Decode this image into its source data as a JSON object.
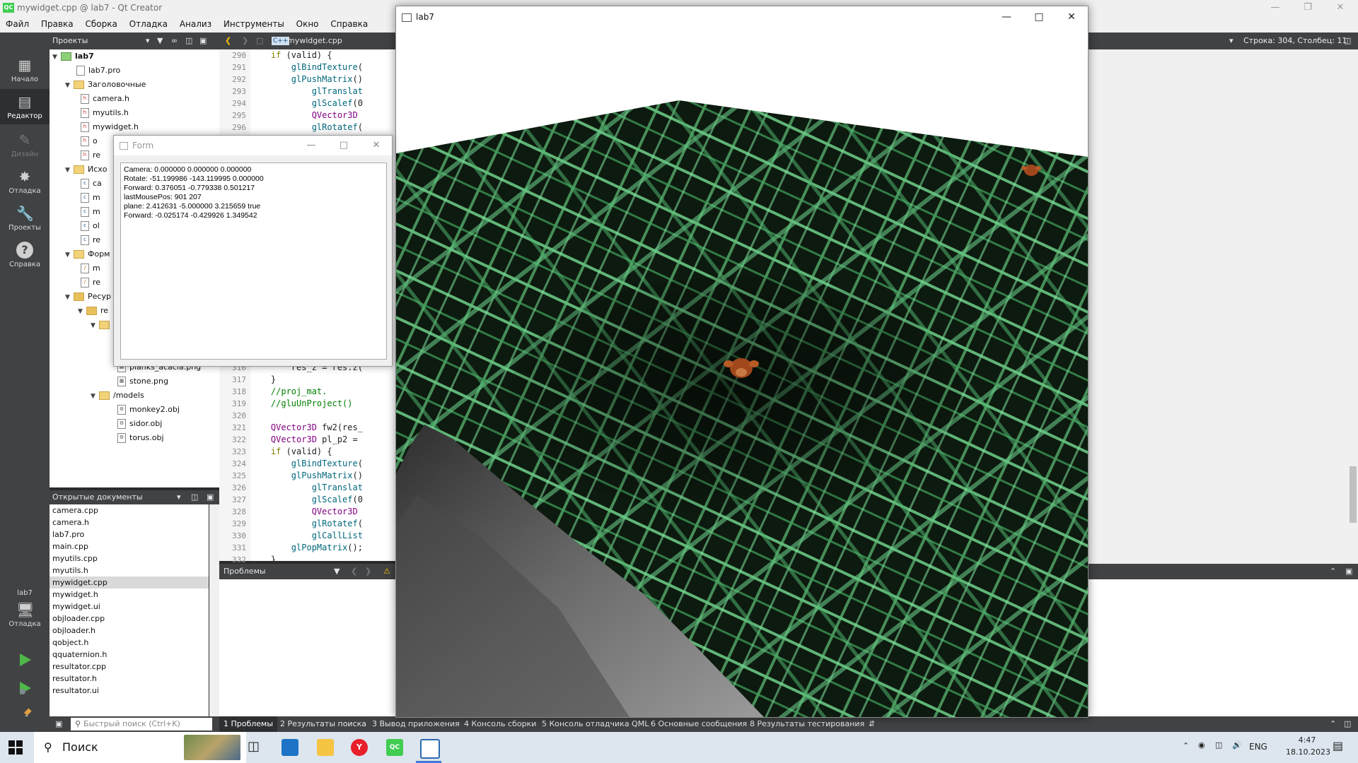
{
  "window_title": "mywidget.cpp @ lab7 - Qt Creator",
  "menu": [
    "Файл",
    "Правка",
    "Сборка",
    "Отладка",
    "Анализ",
    "Инструменты",
    "Окно",
    "Справка"
  ],
  "modes": [
    {
      "label": "Начало",
      "icon": "grid-icon"
    },
    {
      "label": "Редактор",
      "icon": "editor-icon"
    },
    {
      "label": "Дизайн",
      "icon": "design-pen-icon"
    },
    {
      "label": "Отладка",
      "icon": "debug-bug-icon"
    },
    {
      "label": "Проекты",
      "icon": "wrench-icon"
    },
    {
      "label": "Справка",
      "icon": "help-icon"
    }
  ],
  "kit": {
    "name": "lab7",
    "mode": "Отладка"
  },
  "toolbar": {
    "projects_label": "Проекты",
    "file_tab": "mywidget.cpp",
    "cursor_pos": "Строка: 304, Столбец: 11"
  },
  "tree": {
    "root": "lab7",
    "pro": "lab7.pro",
    "headers_folder": "Заголовочные",
    "headers": [
      "camera.h",
      "myutils.h",
      "mywidget.h",
      "o",
      "re"
    ],
    "sources_folder": "Исхо",
    "sources": [
      "ca",
      "m",
      "m",
      "ol",
      "re"
    ],
    "forms_folder": "Форм",
    "forms": [
      "m",
      "re"
    ],
    "resources_folder": "Ресур",
    "resources_sub": "re",
    "textures": [
      "planks_acacia.png",
      "stone.png"
    ],
    "models_folder": "/models",
    "models": [
      "monkey2.obj",
      "sidor.obj",
      "torus.obj"
    ]
  },
  "opendocs": {
    "title": "Открытые документы",
    "items": [
      "camera.cpp",
      "camera.h",
      "lab7.pro",
      "main.cpp",
      "myutils.cpp",
      "myutils.h",
      "mywidget.cpp",
      "mywidget.h",
      "mywidget.ui",
      "objloader.cpp",
      "objloader.h",
      "qobject.h",
      "qquaternion.h",
      "resultator.cpp",
      "resultator.h",
      "resultator.ui"
    ],
    "selected": "mywidget.cpp"
  },
  "code": {
    "top_lines": [
      {
        "n": "290",
        "t": "    if (valid) {"
      },
      {
        "n": "291",
        "t": "        glBindTexture("
      },
      {
        "n": "292",
        "t": "        glPushMatrix()"
      },
      {
        "n": "293",
        "t": "            glTranslat"
      },
      {
        "n": "294",
        "t": "            glScalef(0"
      },
      {
        "n": "295",
        "t": "            QVector3D"
      },
      {
        "n": "296",
        "t": "            glRotatef("
      }
    ],
    "bottom_lines": [
      {
        "n": "316",
        "t": "        res_z = res.z("
      },
      {
        "n": "317",
        "t": "    }"
      },
      {
        "n": "318",
        "t": "    //proj_mat."
      },
      {
        "n": "319",
        "t": "    //gluUnProject()"
      },
      {
        "n": "320",
        "t": ""
      },
      {
        "n": "321",
        "t": "    QVector3D fw2(res_"
      },
      {
        "n": "322",
        "t": "    QVector3D pl_p2 ="
      },
      {
        "n": "323",
        "t": "    if (valid) {"
      },
      {
        "n": "324",
        "t": "        glBindTexture("
      },
      {
        "n": "325",
        "t": "        glPushMatrix()"
      },
      {
        "n": "326",
        "t": "            glTranslat"
      },
      {
        "n": "327",
        "t": "            glScalef(0"
      },
      {
        "n": "328",
        "t": "            QVector3D"
      },
      {
        "n": "329",
        "t": "            glRotatef("
      },
      {
        "n": "330",
        "t": "            glCallList"
      },
      {
        "n": "331",
        "t": "        glPopMatrix();"
      },
      {
        "n": "332",
        "t": "    }"
      }
    ]
  },
  "problems": {
    "title": "Проблемы"
  },
  "bottom": {
    "search_placeholder": "Быстрый поиск (Ctrl+K)",
    "tabs": [
      "1 Проблемы",
      "2 Результаты поиска",
      "3 Вывод приложения",
      "4 Консоль сборки",
      "5 Консоль отладчика QML",
      "6 Основные сообщения",
      "8 Результаты тестирования"
    ]
  },
  "lab7_window": {
    "title": "lab7"
  },
  "form_window": {
    "title": "Form",
    "lines": [
      "Camera: 0.000000 0.000000 0.000000",
      "Rotate: -51.199986 -143.119995 0.000000",
      "Forward: 0.376051 -0.779338 0.501217",
      "lastMousePos: 901 207",
      "plane: 2.412631 -5.000000 3.215659 true",
      "Forward: -0.025174 -0.429926 1.349542"
    ]
  },
  "taskbar": {
    "search": "Поиск",
    "lang": "ENG",
    "time": "4:47",
    "date": "18.10.2023"
  }
}
